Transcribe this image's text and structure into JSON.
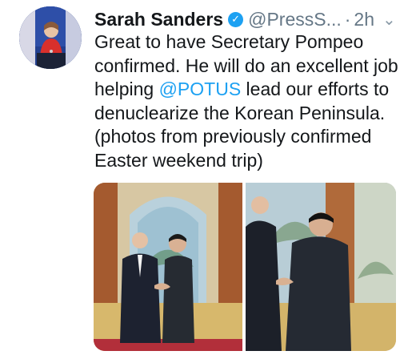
{
  "tweet": {
    "author_name": "Sarah Sanders",
    "handle": "@PressS...",
    "separator": "·",
    "timestamp": "2h",
    "text_before_mention": "Great to have Secretary Pompeo confirmed. He will do an excellent job helping ",
    "mention": "@POTUS",
    "text_after_mention": " lead our efforts to denuclearize the Korean Peninsula. (photos from previously confirmed Easter weekend trip)"
  },
  "icons": {
    "verified": "verified-badge-icon",
    "menu": "chevron-down-icon"
  },
  "colors": {
    "link": "#1da1f2",
    "secondary_text": "#657786",
    "verified": "#1da1f2"
  }
}
